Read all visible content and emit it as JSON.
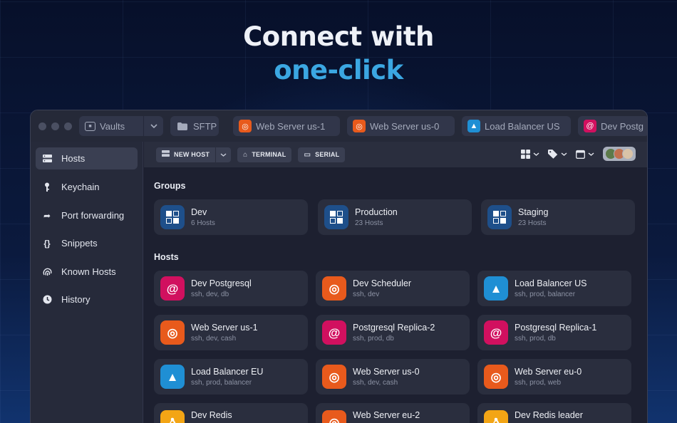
{
  "hero": {
    "line1": "Connect with",
    "line2": "one-click"
  },
  "titlebar": {
    "vaults_label": "Vaults",
    "sftp_label": "SFTP",
    "tabs": [
      {
        "label": "Web Server us-1",
        "os": "ubuntu"
      },
      {
        "label": "Web Server us-0",
        "os": "ubuntu"
      },
      {
        "label": "Load Balancer US",
        "os": "arch"
      },
      {
        "label": "Dev Postg",
        "os": "debian"
      }
    ]
  },
  "sidebar": {
    "items": [
      {
        "label": "Hosts",
        "icon": "hosts-icon",
        "active": true
      },
      {
        "label": "Keychain",
        "icon": "key-icon"
      },
      {
        "label": "Port forwarding",
        "icon": "port-forward-icon"
      },
      {
        "label": "Snippets",
        "icon": "braces-icon"
      },
      {
        "label": "Known Hosts",
        "icon": "fingerprint-icon"
      },
      {
        "label": "History",
        "icon": "clock-icon"
      }
    ]
  },
  "toolbar": {
    "new_host": "NEW HOST",
    "terminal": "TERMINAL",
    "serial": "SERIAL"
  },
  "groups": {
    "title": "Groups",
    "items": [
      {
        "name": "Dev",
        "count": "6 Hosts"
      },
      {
        "name": "Production",
        "count": "23 Hosts"
      },
      {
        "name": "Staging",
        "count": "23 Hosts"
      }
    ]
  },
  "hosts": {
    "title": "Hosts",
    "items": [
      {
        "name": "Dev Postgresql",
        "tags": "ssh, dev, db",
        "os": "debian"
      },
      {
        "name": "Dev Scheduler",
        "tags": "ssh, dev",
        "os": "ubuntu"
      },
      {
        "name": "Load Balancer US",
        "tags": "ssh, prod, balancer",
        "os": "arch"
      },
      {
        "name": "Web Server us-1",
        "tags": "ssh, dev, cash",
        "os": "ubuntu"
      },
      {
        "name": "Postgresql Replica-2",
        "tags": "ssh, prod, db",
        "os": "debian"
      },
      {
        "name": "Postgresql Replica-1",
        "tags": "ssh, prod, db",
        "os": "debian"
      },
      {
        "name": "Load Balancer EU",
        "tags": "ssh, prod, balancer",
        "os": "arch"
      },
      {
        "name": "Web Server us-0",
        "tags": "ssh, dev, cash",
        "os": "ubuntu"
      },
      {
        "name": "Web Server eu-0",
        "tags": "ssh, prod, web",
        "os": "ubuntu"
      },
      {
        "name": "Dev Redis",
        "tags": "",
        "os": "linux"
      },
      {
        "name": "Web Server eu-2",
        "tags": "",
        "os": "ubuntu"
      },
      {
        "name": "Dev Redis leader",
        "tags": "",
        "os": "linux"
      }
    ]
  },
  "colors": {
    "accent_heading": "#3ba7e2",
    "debian": "#d1105f",
    "ubuntu": "#e85a1c",
    "arch": "#1f8fd4",
    "linux": "#f3a515",
    "group": "#1e4f8a"
  }
}
